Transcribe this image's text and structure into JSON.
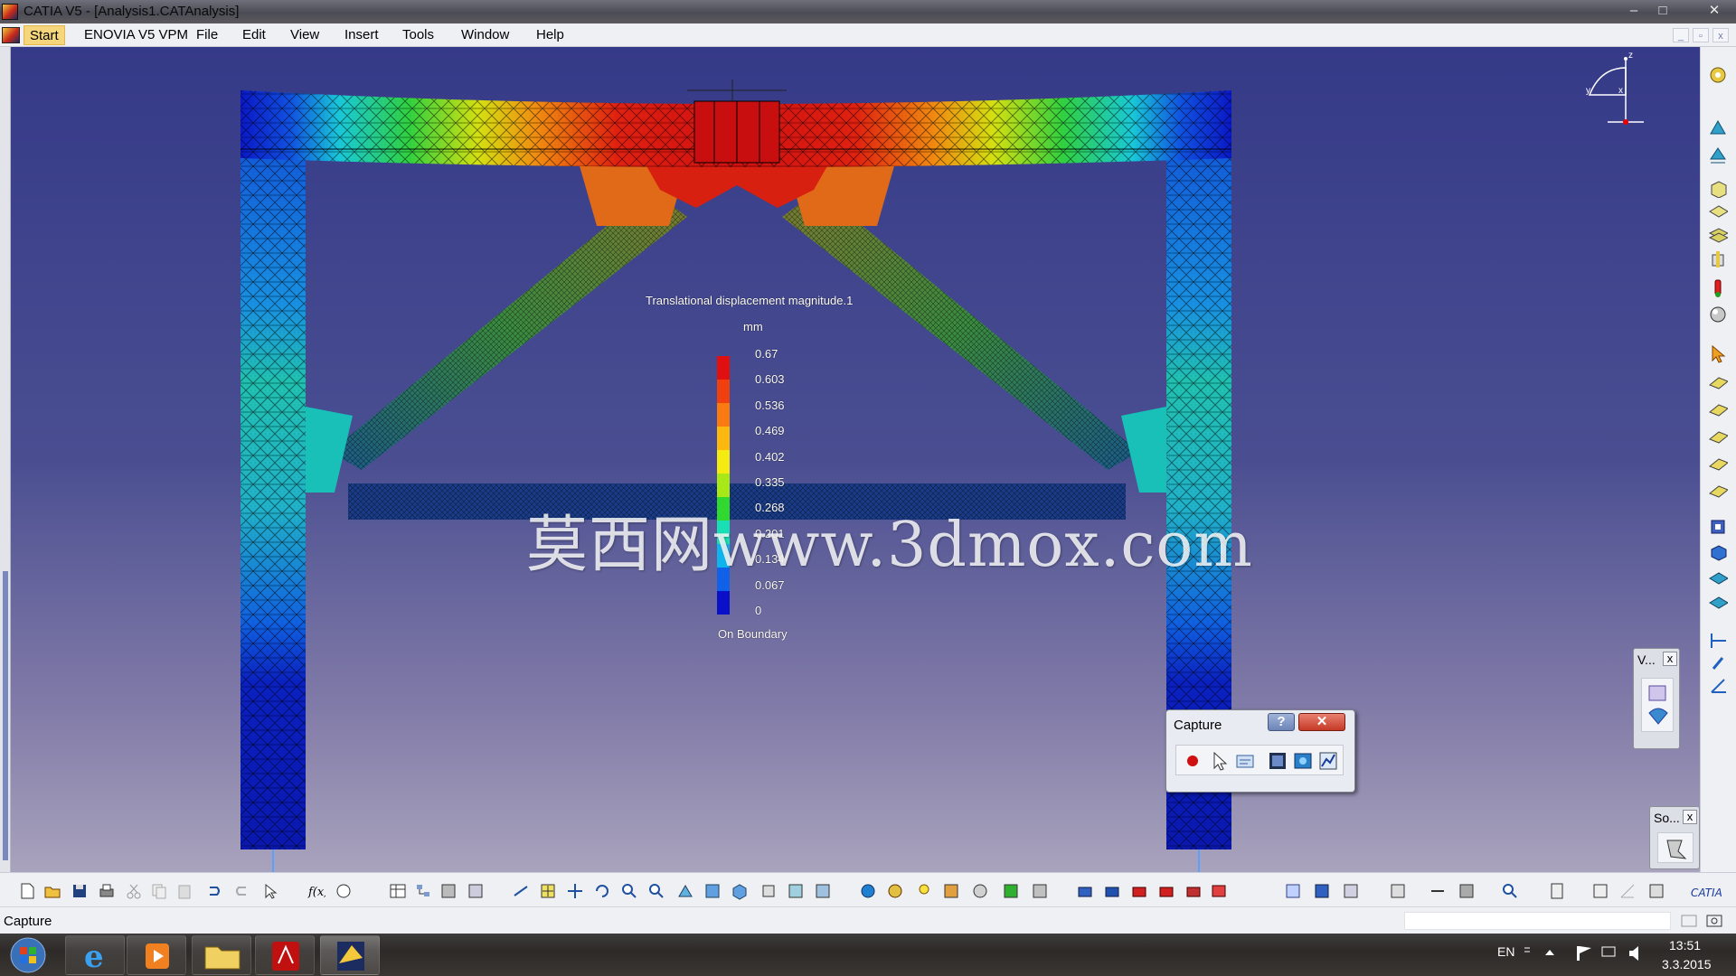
{
  "window": {
    "title": "CATIA V5 - [Analysis1.CATAnalysis]",
    "minimize_glyph": "–",
    "maximize_glyph": "□",
    "close_glyph": "✕",
    "mdi_minimize": "_",
    "mdi_restore": "▫",
    "mdi_close": "x"
  },
  "menu": {
    "items": [
      {
        "label": "Start"
      },
      {
        "label": "ENOVIA V5 VPM"
      },
      {
        "label": "File"
      },
      {
        "label": "Edit"
      },
      {
        "label": "View"
      },
      {
        "label": "Insert"
      },
      {
        "label": "Tools"
      },
      {
        "label": "Window"
      },
      {
        "label": "Help"
      }
    ]
  },
  "compass": {
    "x_label": "x",
    "y_label": "y",
    "z_label": "z"
  },
  "legend": {
    "title": "Translational displacement magnitude.1",
    "unit": "mm",
    "values": [
      "0.67",
      "0.603",
      "0.536",
      "0.469",
      "0.402",
      "0.335",
      "0.268",
      "0.201",
      "0.134",
      "0.067",
      "0"
    ],
    "colors": [
      "#e01010",
      "#f04010",
      "#f87a10",
      "#fcb80e",
      "#f4ec10",
      "#a8e816",
      "#30d830",
      "#18e0b4",
      "#10b4ec",
      "#1060e8",
      "#0a10c8"
    ],
    "footer": "On Boundary"
  },
  "watermark": {
    "text": "莫西网www.3dmox.com"
  },
  "capture_toolbar": {
    "title": "Capture",
    "help_glyph": "?",
    "close_glyph": "✕",
    "icons": [
      "record-icon",
      "select-icon",
      "options-icon",
      "capture-icon",
      "album-icon",
      "chart-icon"
    ]
  },
  "palettes": {
    "view_palette": {
      "title": "V...",
      "close_glyph": "x"
    },
    "solve_palette": {
      "title": "So...",
      "close_glyph": "x"
    }
  },
  "status": {
    "text": "Capture"
  },
  "taskbar": {
    "language": "EN",
    "time": "13:51",
    "date": "3.3.2015"
  },
  "colors": {
    "viewport_top": "#353a88",
    "viewport_bottom": "#a9a3bd",
    "accent_menu": "#f5d67d"
  }
}
